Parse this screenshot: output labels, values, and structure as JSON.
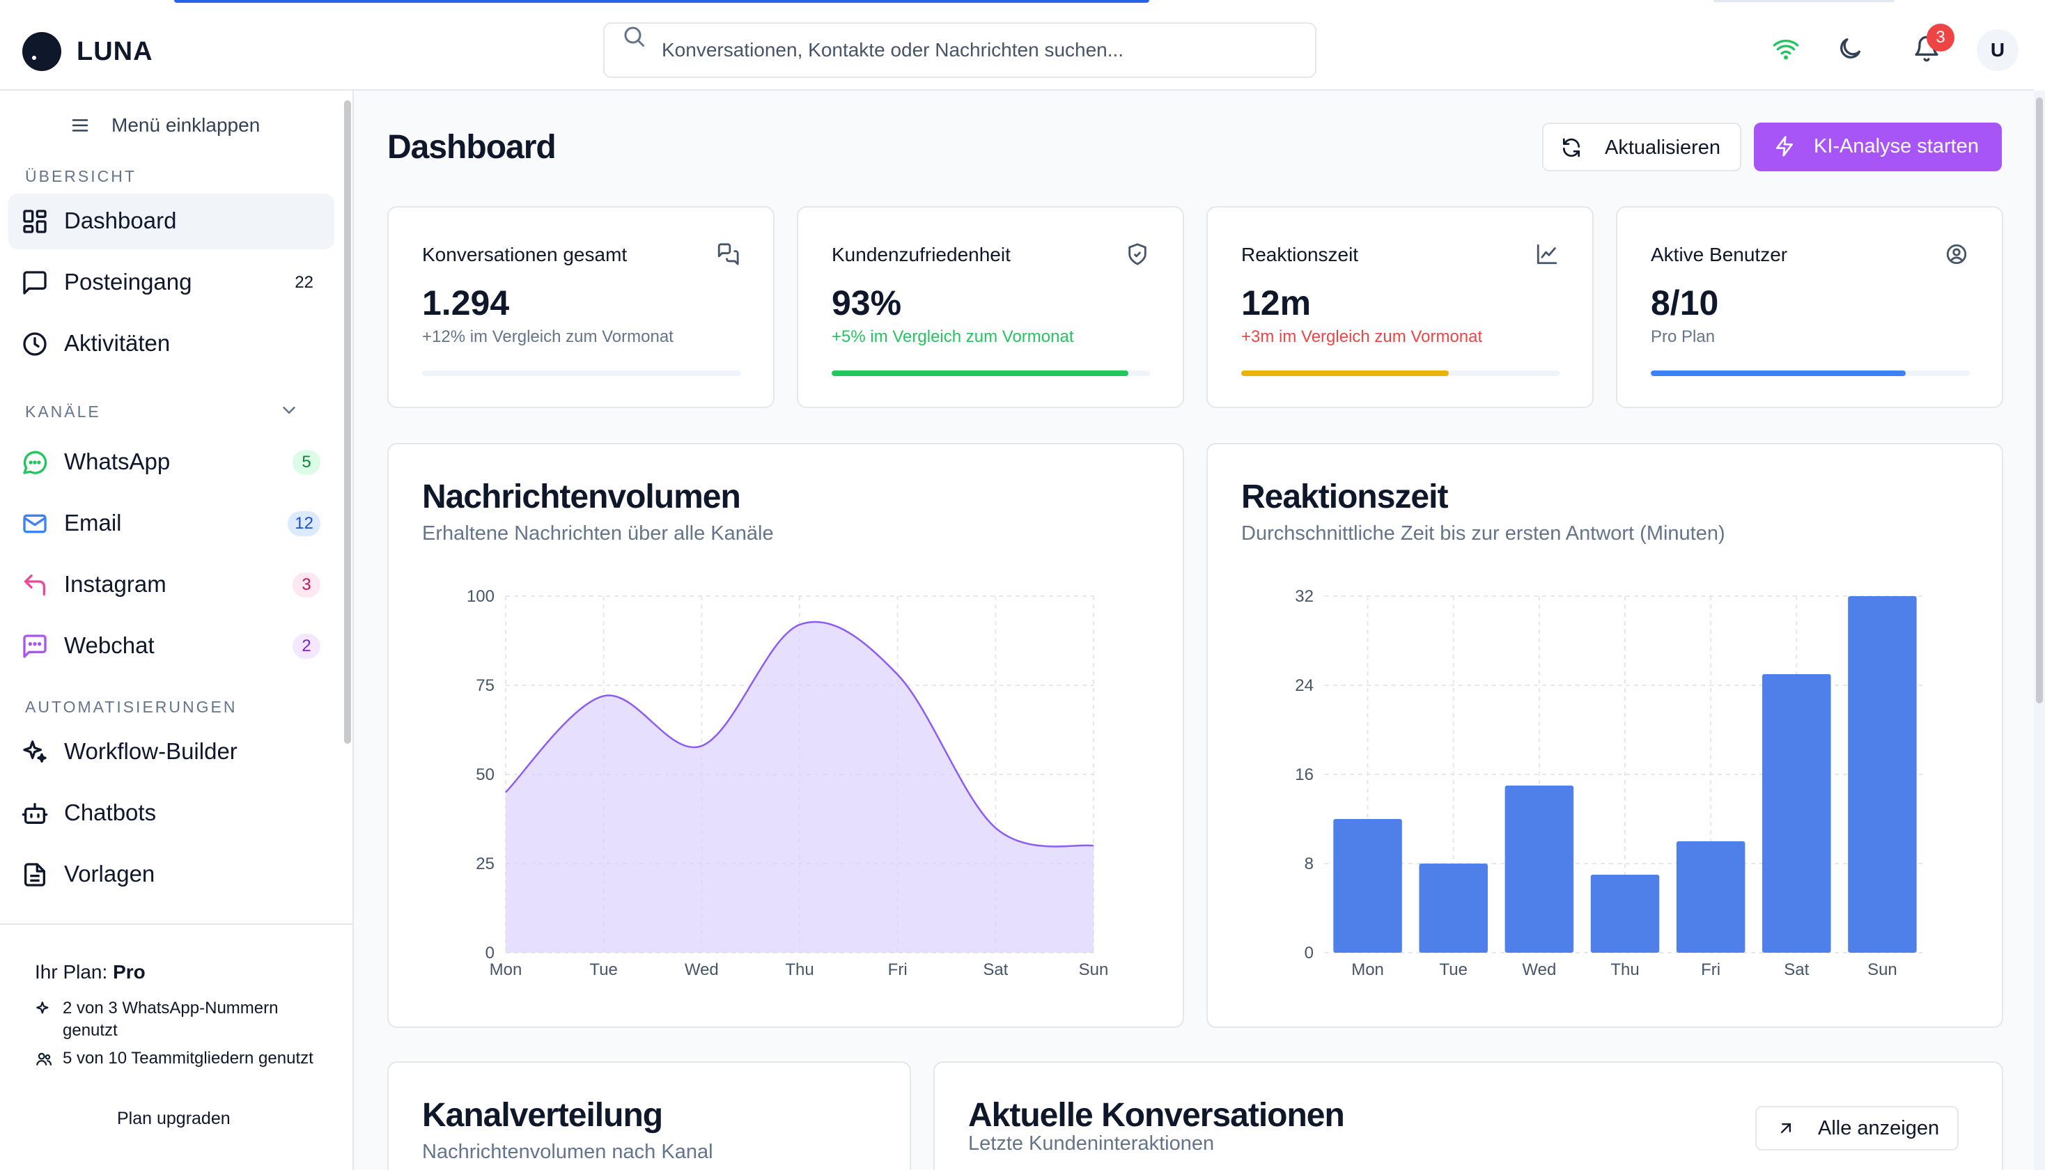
{
  "app": {
    "name": "LUNA"
  },
  "search": {
    "placeholder": "Konversationen, Kontakte oder Nachrichten suchen..."
  },
  "header": {
    "notification_count": "3",
    "avatar_initial": "U"
  },
  "sidebar": {
    "collapse_label": "Menü einklappen",
    "overview_label": "ÜBERSICHT",
    "overview_items": [
      {
        "label": "Dashboard"
      },
      {
        "label": "Posteingang",
        "count": "22"
      },
      {
        "label": "Aktivitäten"
      }
    ],
    "channels_label": "KANÄLE",
    "channels": [
      {
        "label": "WhatsApp",
        "count": "5",
        "color": "#22c55e"
      },
      {
        "label": "Email",
        "count": "12",
        "color": "#3b82f6"
      },
      {
        "label": "Instagram",
        "count": "3",
        "color": "#ec4899"
      },
      {
        "label": "Webchat",
        "count": "2",
        "color": "#a855f7"
      }
    ],
    "automation_label": "AUTOMATISIERUNGEN",
    "automations": [
      {
        "label": "Workflow-Builder"
      },
      {
        "label": "Chatbots"
      },
      {
        "label": "Vorlagen"
      }
    ],
    "plan": {
      "prefix": "Ihr Plan: ",
      "name": "Pro",
      "whatsapp_usage": "2 von 3 WhatsApp-Nummern genutzt",
      "team_usage": "5 von 10 Teammitgliedern genutzt",
      "upgrade_label": "Plan upgraden"
    }
  },
  "main": {
    "title": "Dashboard",
    "refresh_label": "Aktualisieren",
    "ai_label": "KI-Analyse starten",
    "kpis": [
      {
        "title": "Konversationen gesamt",
        "value": "1.294",
        "sub": "+12% im Vergleich zum Vormonat",
        "progress": 0,
        "color": "#64748b",
        "bar_color": "#f1f5f9"
      },
      {
        "title": "Kundenzufriedenheit",
        "value": "93%",
        "sub": "+5% im Vergleich zum Vormonat",
        "progress": 0.93,
        "color": "#22c55e",
        "bar_color": "#22c55e"
      },
      {
        "title": "Reaktionszeit",
        "value": "12m",
        "sub": "+3m im Vergleich zum Vormonat",
        "progress": 0.65,
        "color": "#ef4444",
        "bar_color": "#eab308"
      },
      {
        "title": "Aktive Benutzer",
        "value": "8/10",
        "sub": "Pro Plan",
        "progress": 0.8,
        "color": "#64748b",
        "bar_color": "#3b82f6"
      }
    ],
    "channel_dist": {
      "title": "Kanalverteilung",
      "subtitle": "Nachrichtenvolumen nach Kanal"
    },
    "recent": {
      "title": "Aktuelle Konversationen",
      "subtitle": "Letzte Kundeninteraktionen",
      "all_label": "Alle anzeigen"
    }
  },
  "chart_data": [
    {
      "type": "area",
      "title": "Nachrichtenvolumen",
      "subtitle": "Erhaltene Nachrichten über alle Kanäle",
      "categories": [
        "Mon",
        "Tue",
        "Wed",
        "Thu",
        "Fri",
        "Sat",
        "Sun"
      ],
      "values": [
        45,
        72,
        58,
        92,
        78,
        35,
        30
      ],
      "ylim": [
        0,
        100
      ],
      "yticks": [
        0,
        25,
        50,
        75,
        100
      ],
      "grid": true,
      "color": "#8b5cf6"
    },
    {
      "type": "bar",
      "title": "Reaktionszeit",
      "subtitle": "Durchschnittliche Zeit bis zur ersten Antwort (Minuten)",
      "categories": [
        "Mon",
        "Tue",
        "Wed",
        "Thu",
        "Fri",
        "Sat",
        "Sun"
      ],
      "values": [
        12,
        8,
        15,
        7,
        10,
        25,
        32
      ],
      "ylim": [
        0,
        32
      ],
      "yticks": [
        0,
        8,
        16,
        24,
        32
      ],
      "grid": true,
      "color": "#4f80ea"
    }
  ]
}
